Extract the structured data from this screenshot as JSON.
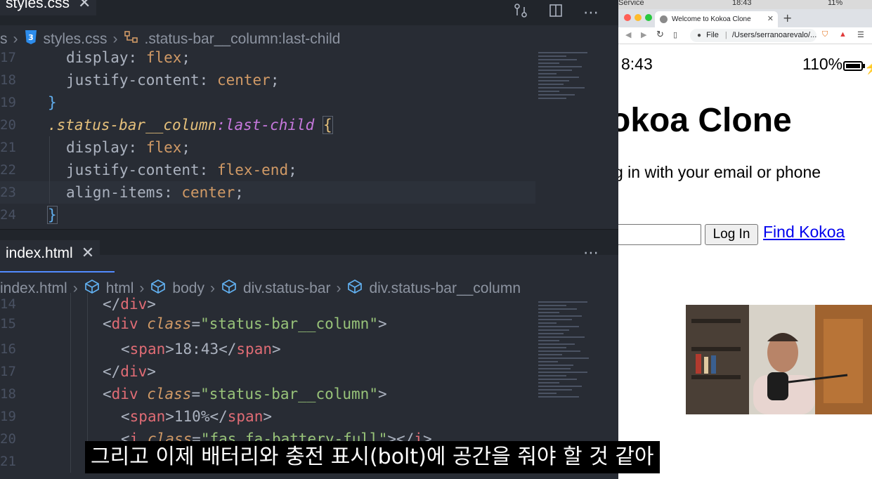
{
  "editor_top": {
    "tab_label": "styles.css",
    "breadcrumb": [
      "s",
      "styles.css",
      ".status-bar__column:last-child"
    ],
    "line_numbers": [
      "17",
      "18",
      "19",
      "20",
      "21",
      "22",
      "23",
      "24"
    ],
    "lines": [
      {
        "prop": "display",
        "val": "flex"
      },
      {
        "prop": "justify-content",
        "val": "center"
      },
      {
        "brace": "}"
      },
      {
        "selector": ".status-bar__column",
        "pseudo": ":last-child",
        "open": "{"
      },
      {
        "prop": "display",
        "val": "flex"
      },
      {
        "prop": "justify-content",
        "val": "flex-end"
      },
      {
        "prop": "align-items",
        "val": "center"
      },
      {
        "brace": "}"
      }
    ]
  },
  "editor_bottom": {
    "tab_label": "index.html",
    "breadcrumb": [
      "index.html",
      "html",
      "body",
      "div.status-bar",
      "div.status-bar__column"
    ],
    "line_numbers": [
      "14",
      "15",
      "16",
      "17",
      "18",
      "19",
      "20",
      "21"
    ],
    "lines": [
      "</div>",
      "<div class=\"status-bar__column\">",
      "<span>18:43</span>",
      "</div>",
      "<div class=\"status-bar__column\">",
      "<span>110%</span>",
      "<i class=\"fas fa-battery-full\"></i>"
    ]
  },
  "icons": {
    "close": "close-icon",
    "more": "more-icon",
    "split": "split-editor-icon",
    "branch": "compare-icon"
  },
  "browser": {
    "menubar_left": "Service",
    "menubar_center": "18:43",
    "menubar_right": "11%",
    "tab_title": "Welcome to Kokoa Clone",
    "address": "/Users/serranoarevalo/...",
    "address_scheme": "File",
    "phone_time": "8:43",
    "phone_battery": "110%",
    "title": "okoa Clone",
    "subtitle": "g in with your email or phone",
    "button": "Log In",
    "link": "Find Kokoa"
  },
  "subtitle_text": "그리고 이제 배터리와 충전 표시(bolt)에 공간을 줘야 할 것 같아",
  "colors": {
    "editor_bg": "#282c34",
    "tab_underline": "#528bff",
    "link": "#0000ee"
  }
}
